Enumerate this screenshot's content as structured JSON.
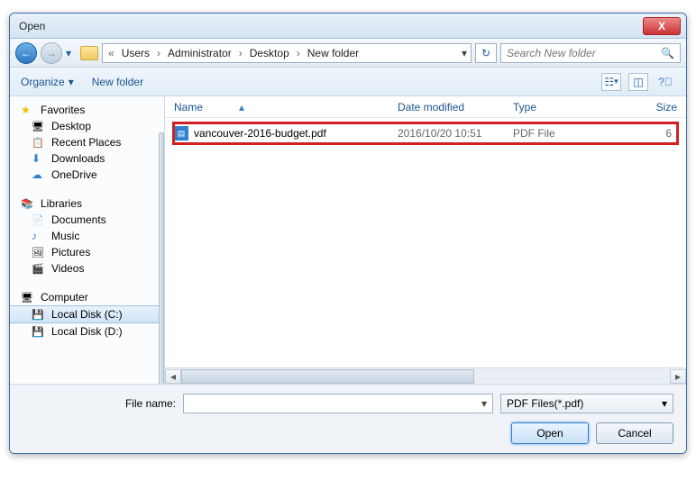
{
  "title": "Open",
  "breadcrumb": {
    "sep": "«",
    "items": [
      "Users",
      "Administrator",
      "Desktop",
      "New folder"
    ]
  },
  "search": {
    "placeholder": "Search New folder"
  },
  "toolbar": {
    "organize": "Organize",
    "newfolder": "New folder"
  },
  "sidebar": {
    "favorites": {
      "label": "Favorites",
      "items": [
        "Desktop",
        "Recent Places",
        "Downloads",
        "OneDrive"
      ]
    },
    "libraries": {
      "label": "Libraries",
      "items": [
        "Documents",
        "Music",
        "Pictures",
        "Videos"
      ]
    },
    "computer": {
      "label": "Computer",
      "items": [
        "Local Disk (C:)",
        "Local Disk (D:)"
      ]
    }
  },
  "columns": {
    "name": "Name",
    "date": "Date modified",
    "type": "Type",
    "size": "Size"
  },
  "files": [
    {
      "name": "vancouver-2016-budget.pdf",
      "date": "2016/10/20 10:51",
      "type": "PDF File",
      "size": "6"
    }
  ],
  "filename_label": "File name:",
  "filename_value": "",
  "filter": "PDF Files(*.pdf)",
  "buttons": {
    "open": "Open",
    "cancel": "Cancel"
  }
}
